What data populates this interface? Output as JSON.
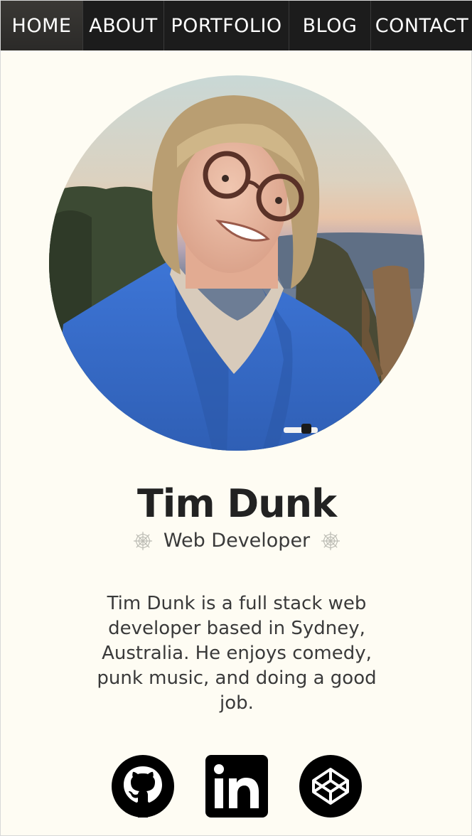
{
  "nav": {
    "items": [
      {
        "label": "HOME",
        "active": true
      },
      {
        "label": "ABOUT",
        "active": false
      },
      {
        "label": "PORTFOLIO",
        "active": false
      },
      {
        "label": "BLOG",
        "active": false
      },
      {
        "label": "CONTACT",
        "active": false
      }
    ]
  },
  "profile": {
    "name": "Tim Dunk",
    "role": "Web Developer",
    "role_icon": "spider-web-icon",
    "bio": "Tim Dunk is a full stack web developer based in Sydney, Australia. He enjoys comedy, punk music, and doing a good job.",
    "avatar": "profile-photo"
  },
  "social": [
    {
      "name": "GitHub",
      "icon": "github-icon"
    },
    {
      "name": "LinkedIn",
      "icon": "linkedin-icon"
    },
    {
      "name": "CodePen",
      "icon": "codepen-icon"
    }
  ],
  "colors": {
    "background": "#fefcf3",
    "navbar": "#1c1c1c",
    "text": "#222222"
  }
}
